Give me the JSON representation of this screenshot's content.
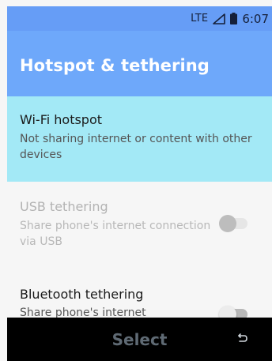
{
  "status_bar": {
    "network": "LTE",
    "time": "6:07",
    "icons": [
      "signal-icon",
      "battery-icon"
    ]
  },
  "app_bar": {
    "title": "Hotspot & tethering"
  },
  "settings": [
    {
      "title": "Wi-Fi hotspot",
      "subtitle": "Not sharing internet or content with other devices",
      "highlighted": true
    },
    {
      "title": "USB tethering",
      "subtitle": "Share phone's internet connection via USB",
      "enabled": false,
      "toggle_on": false
    },
    {
      "title": "Bluetooth tethering",
      "subtitle": "Share phone's internet",
      "enabled": true,
      "toggle_on": false
    }
  ],
  "softkeys": {
    "center": "Select",
    "right_icon": "back-icon"
  },
  "colors": {
    "status_bar": "#669df6",
    "app_bar": "#6ea8fa",
    "highlight": "#a3e9f6",
    "background": "#f6f6f6",
    "softkey_bar": "#000000"
  }
}
